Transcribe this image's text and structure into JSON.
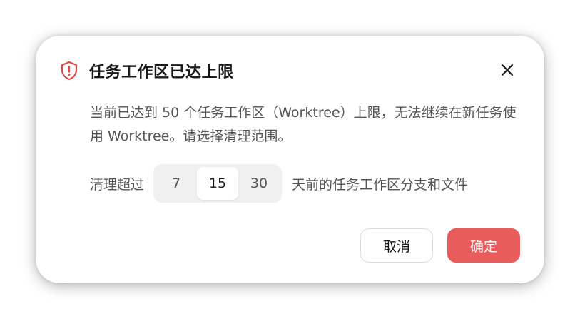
{
  "dialog": {
    "title": "任务工作区已达上限",
    "message": "当前已达到 50 个任务工作区（Worktree）上限，无法继续在新任务使用 Worktree。请选择清理范围。",
    "cleanup": {
      "prefix": "清理超过",
      "options": [
        "7",
        "15",
        "30"
      ],
      "selected": "15",
      "suffix": "天前的任务工作区分支和文件"
    },
    "buttons": {
      "cancel": "取消",
      "confirm": "确定"
    },
    "colors": {
      "accent": "#e85c5c",
      "icon": "#e04848"
    },
    "icons": {
      "title_icon": "shield-alert-icon",
      "close_icon": "close-icon"
    }
  }
}
